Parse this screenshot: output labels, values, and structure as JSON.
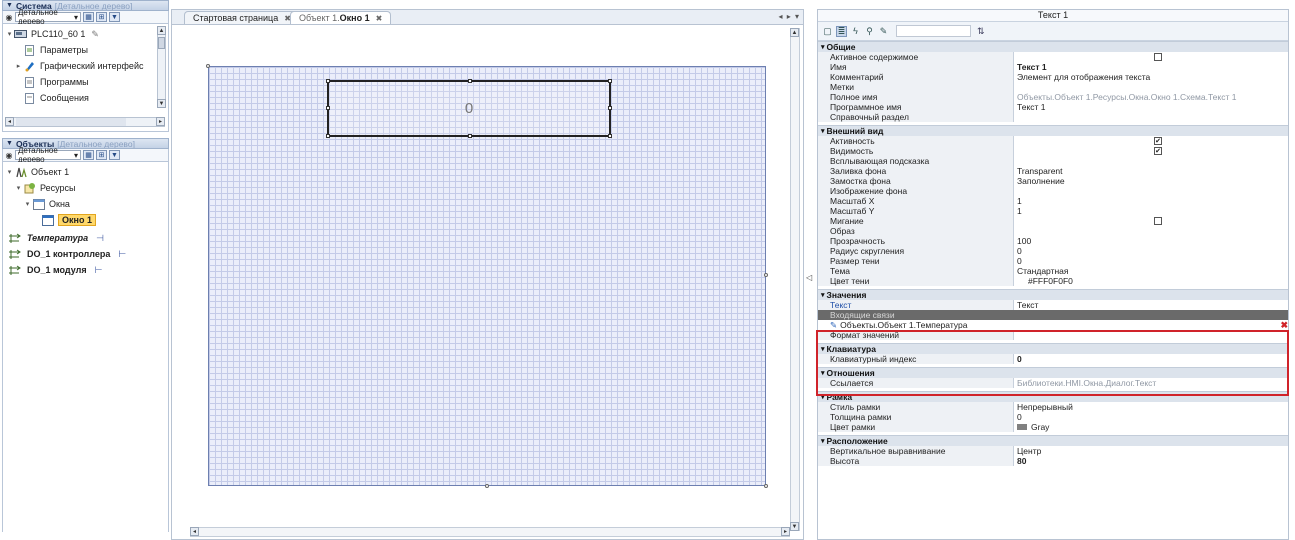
{
  "system_panel": {
    "title": "Система",
    "subtitle": "[Детальное дерево]",
    "view": "Детальное дерево",
    "tree": [
      {
        "label": "PLC110_60 1",
        "level": 0,
        "expanded": true
      },
      {
        "label": "Параметры",
        "level": 1
      },
      {
        "label": "Графический интерфейс",
        "level": 1,
        "expander": true
      },
      {
        "label": "Программы",
        "level": 1
      },
      {
        "label": "Сообщения",
        "level": 1
      }
    ]
  },
  "objects_panel": {
    "title": "Объекты",
    "subtitle": "[Детальное дерево]",
    "view": "Детальное дерево",
    "tree": [
      {
        "label": "Объект 1"
      },
      {
        "label": "Ресурсы"
      },
      {
        "label": "Окна"
      },
      {
        "label": "Окно 1"
      },
      {
        "label": "Температура",
        "suffix": "⊣"
      },
      {
        "label": "DO_1 контроллера",
        "suffix": "⊢"
      },
      {
        "label": "DO_1 модуля",
        "suffix": "⊢"
      }
    ]
  },
  "editor": {
    "tabs": [
      {
        "label": "Стартовая страница",
        "active": false
      },
      {
        "prefix": "Объект 1.",
        "label": "Окно 1",
        "active": true
      }
    ],
    "text_element_value": "0",
    "tab_controls": "◂ ▸ ▾"
  },
  "properties": {
    "title": "Текст 1",
    "groups": {
      "general": {
        "title": "Общие",
        "rows": [
          {
            "name": "Активное содержимое",
            "checkbox": false
          },
          {
            "name": "Имя",
            "value": "Текст 1",
            "bold": true
          },
          {
            "name": "Комментарий",
            "value": "Элемент для отображения текста"
          },
          {
            "name": "Метки",
            "value": ""
          },
          {
            "name": "Полное имя",
            "value": "Объекты.Объект 1.Ресурсы.Окна.Окно 1.Схема.Текст 1",
            "gray": true
          },
          {
            "name": "Программное имя",
            "value": "Текст 1"
          },
          {
            "name": "Справочный раздел",
            "value": ""
          }
        ]
      },
      "appearance": {
        "title": "Внешний вид",
        "rows": [
          {
            "name": "Активность",
            "checkbox": true
          },
          {
            "name": "Видимость",
            "checkbox": true
          },
          {
            "name": "Всплывающая подсказка",
            "value": ""
          },
          {
            "name": "Заливка фона",
            "value": "Transparent"
          },
          {
            "name": "Замостка фона",
            "value": "Заполнение"
          },
          {
            "name": "Изображение фона",
            "value": ""
          },
          {
            "name": "Масштаб X",
            "value": "1"
          },
          {
            "name": "Масштаб Y",
            "value": "1"
          },
          {
            "name": "Мигание",
            "checkbox": false
          },
          {
            "name": "Образ",
            "value": ""
          },
          {
            "name": "Прозрачность",
            "value": "100"
          },
          {
            "name": "Радиус скругления",
            "value": "0"
          },
          {
            "name": "Размер тени",
            "value": "0"
          },
          {
            "name": "Тема",
            "value": "Стандартная"
          },
          {
            "name": "Цвет тени",
            "value": "#FFF0F0F0"
          }
        ]
      },
      "values": {
        "title": "Значения",
        "text_name": "Текст",
        "text_value": "Текст",
        "incoming_links": "Входящие связи",
        "link_value": "Объекты.Объект 1.Температура",
        "format_name": "Формат значений"
      },
      "keyboard": {
        "title": "Клавиатура",
        "rows": [
          {
            "name": "Клавиатурный индекс",
            "value": "0",
            "bold": true
          }
        ]
      },
      "relations": {
        "title": "Отношения",
        "rows": [
          {
            "name": "Ссылается",
            "value": "Библиотеки.HMI.Окна.Диалог.Текст",
            "gray": true
          }
        ]
      },
      "frame": {
        "title": "Рамка",
        "rows": [
          {
            "name": "Стиль рамки",
            "value": "Непрерывный"
          },
          {
            "name": "Толщина рамки",
            "value": "0"
          },
          {
            "name": "Цвет рамки",
            "value": "Gray",
            "swatch": "#808080"
          }
        ]
      },
      "layout": {
        "title": "Расположение",
        "rows": [
          {
            "name": "Вертикальное выравнивание",
            "value": "Центр"
          },
          {
            "name": "Высота",
            "value": "80",
            "bold": true
          }
        ]
      }
    }
  },
  "colors": {
    "accent": "#d0232a",
    "selection": "#ffd86a",
    "canvas": "#ebeefa"
  }
}
